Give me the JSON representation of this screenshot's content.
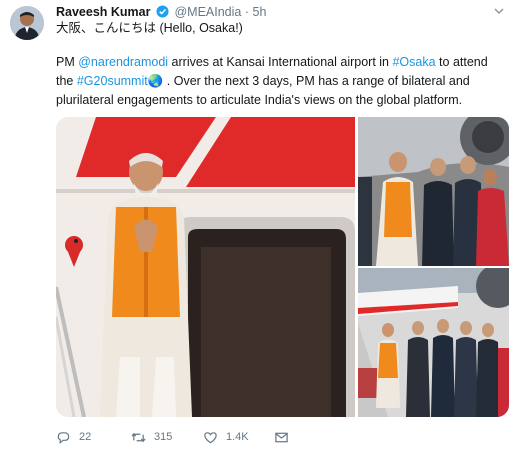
{
  "tweet": {
    "author_name": "Raveesh Kumar",
    "handle": "@MEAIndia",
    "separator": "·",
    "time": "5h",
    "first_line": "大阪、こんにちは (Hello, Osaka!)",
    "body_parts": [
      {
        "text": "PM ",
        "type": "text"
      },
      {
        "text": "@narendramodi",
        "type": "mention"
      },
      {
        "text": " arrives at Kansai International airport in ",
        "type": "text"
      },
      {
        "text": "#Osaka",
        "type": "hashtag"
      },
      {
        "text": " to attend the ",
        "type": "text"
      },
      {
        "text": "#G20summit",
        "type": "hashtag"
      },
      {
        "text": "🌏",
        "type": "emoji"
      },
      {
        "text": " . Over the next 3 days, PM has a range of bilateral and plurilateral engagements to articulate India's views on the global platform.",
        "type": "text"
      }
    ]
  },
  "images": [
    {
      "name": "arrival-at-aircraft-door"
    },
    {
      "name": "greeting-delegation"
    },
    {
      "name": "walking-on-tarmac"
    }
  ],
  "actions": {
    "reply_count": "22",
    "retweet_count": "315",
    "like_count": "1.4K",
    "icons": [
      "reply-icon",
      "retweet-icon",
      "like-icon",
      "direct-message-icon"
    ]
  },
  "colors": {
    "link": "#1b95e0",
    "text": "#14171a",
    "muted": "#657786",
    "verified": "#1da1f2",
    "aircraft_red": "#e02a2a",
    "vest_saffron": "#f08a1c"
  }
}
